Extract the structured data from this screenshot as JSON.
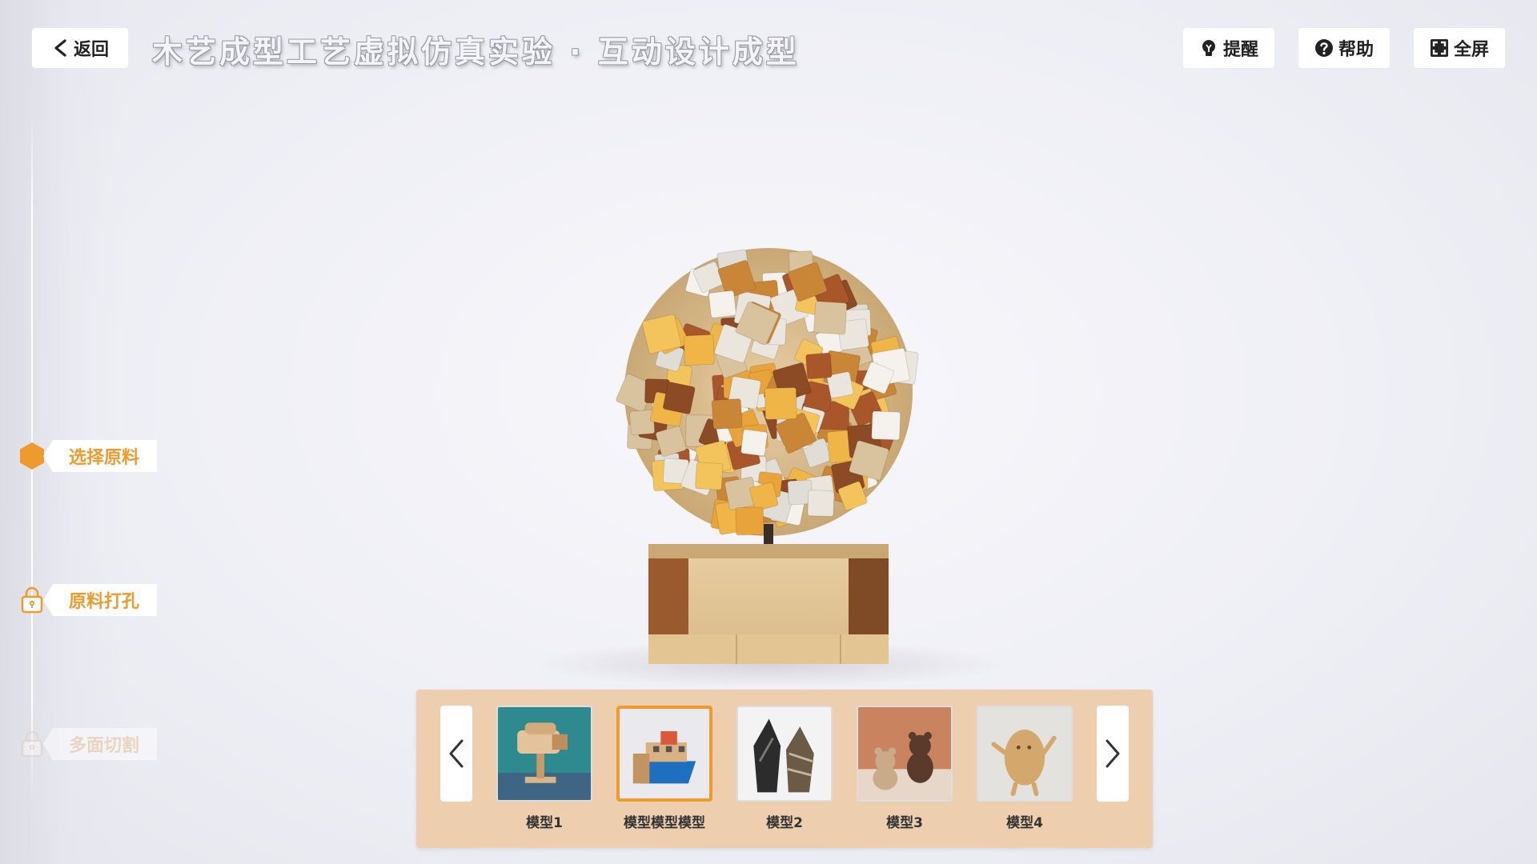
{
  "header": {
    "back_label": "返回",
    "title": "木艺成型工艺虚拟仿真实验 · 互动设计成型"
  },
  "actions": [
    {
      "label": "提醒",
      "icon": "bulb-icon"
    },
    {
      "label": "帮助",
      "icon": "help-icon"
    },
    {
      "label": "全屏",
      "icon": "fullscreen-icon"
    }
  ],
  "steps": [
    {
      "label": "选择原料",
      "state": "active",
      "icon": "hexagon-icon"
    },
    {
      "label": "原料打孔",
      "state": "locked",
      "icon": "lock-icon"
    },
    {
      "label": "多面切割",
      "state": "disabled",
      "icon": "lock-icon"
    }
  ],
  "colors": {
    "accent": "#ef9a2e",
    "picker_bg": "#edcfaf"
  },
  "models": [
    {
      "label": "模型1",
      "selected": false
    },
    {
      "label": "模型模型模型",
      "selected": true
    },
    {
      "label": "模型2",
      "selected": false
    },
    {
      "label": "模型3",
      "selected": false
    },
    {
      "label": "模型4",
      "selected": false
    }
  ]
}
